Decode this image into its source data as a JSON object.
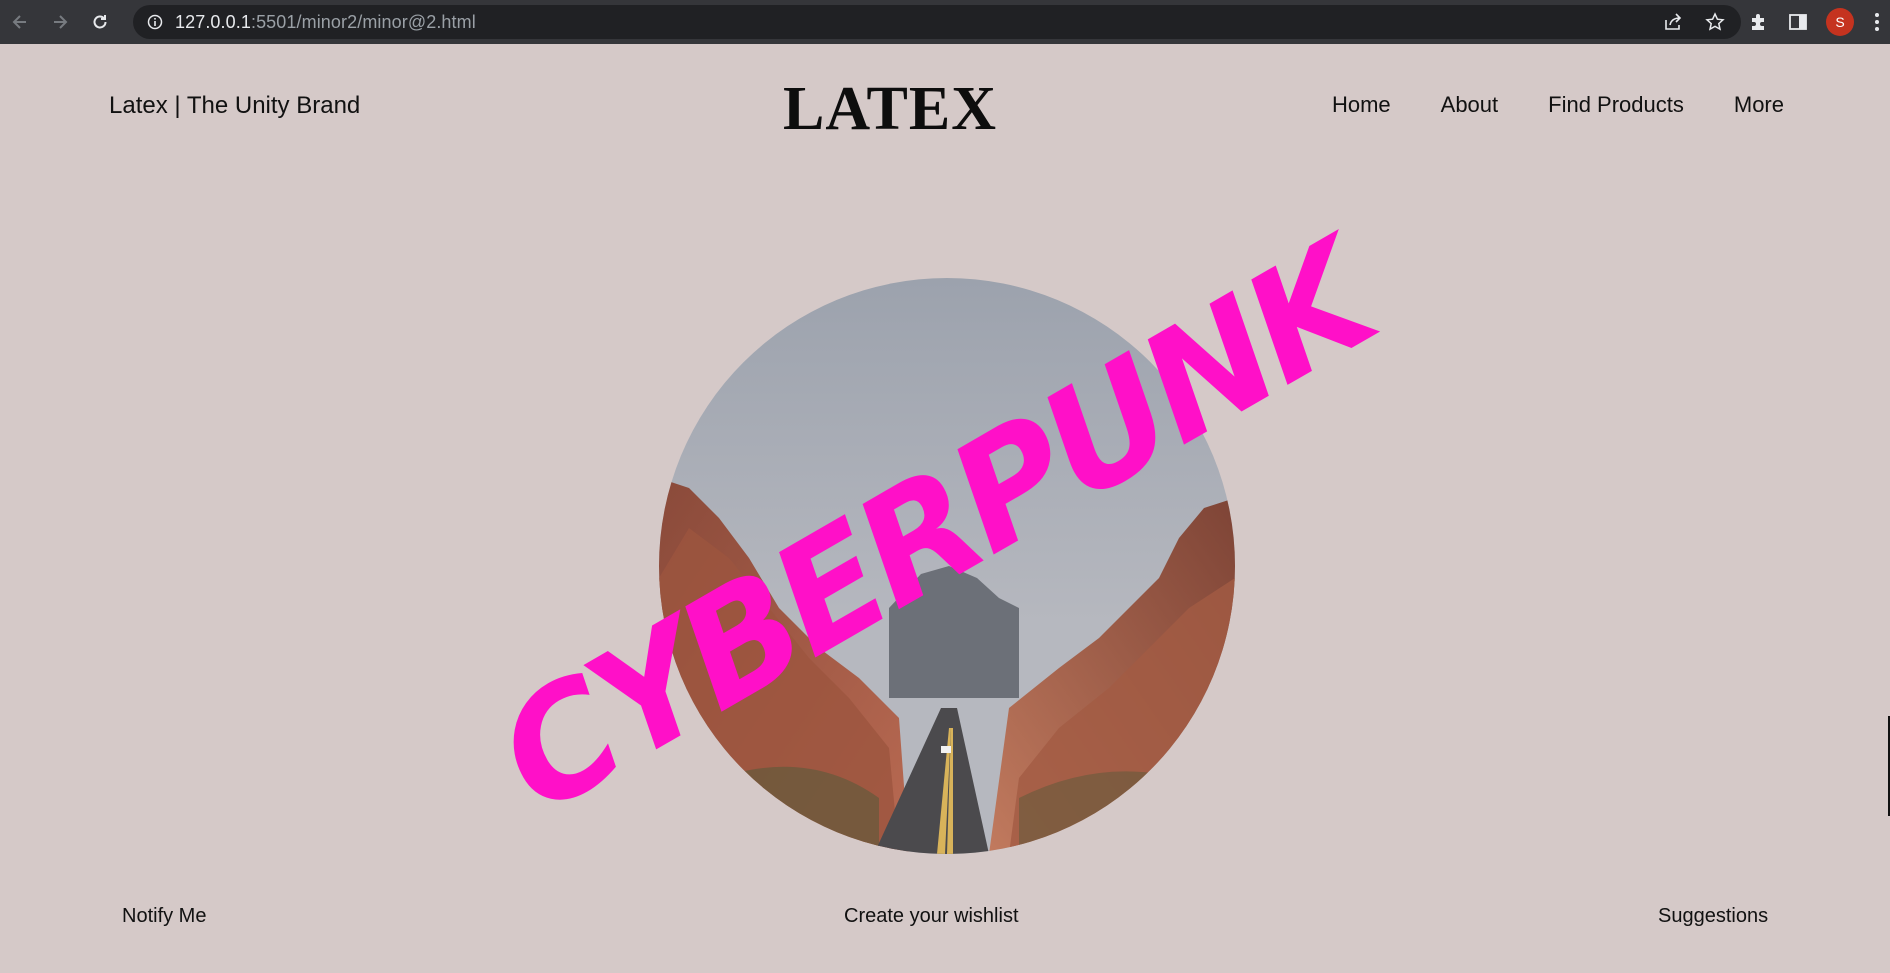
{
  "browser": {
    "url_host": "127.0.0.1",
    "url_rest": ":5501/minor2/minor@2.html",
    "profile_initial": "S"
  },
  "header": {
    "brand": "Latex | The Unity Brand",
    "logo": "LATEX",
    "nav": [
      "Home",
      "About",
      "Find Products",
      "More"
    ]
  },
  "hero": {
    "overlay_text": "CYBERPUNK",
    "overlay_color": "#ff10c8"
  },
  "footer": {
    "links": [
      "Notify Me",
      "Create your wishlist",
      "Suggestions"
    ]
  }
}
